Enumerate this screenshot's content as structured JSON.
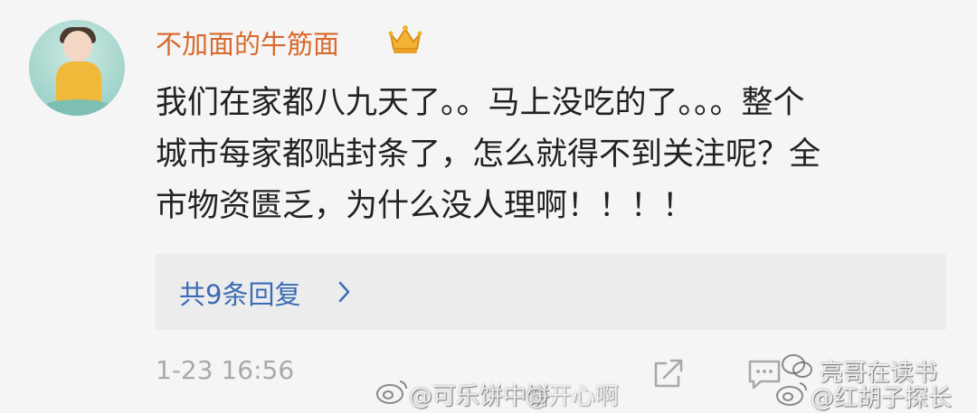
{
  "post": {
    "username": "不加面的牛筋面",
    "comment_lines": [
      "我们在家都八九天了。。马上没吃的了。。。整个",
      "城市每家都贴封条了，怎么就得不到关注呢？全",
      "市物资匮乏，为什么没人理啊！！！！"
    ],
    "replies_label": "共9条回复",
    "timestamp": "1-23 16:56"
  },
  "icons": {
    "badge": "crown-icon",
    "replies": "chevron-right-icon",
    "share": "share-icon",
    "comment": "comment-icon"
  },
  "watermarks": {
    "left": "@可乐饼中饼",
    "overlap": "@开心啊",
    "right_top": "亮哥在读书",
    "right_bottom": "@红胡子探长"
  },
  "colors": {
    "username": "#d9682c",
    "link": "#3a6bb5",
    "text": "#222222",
    "meta": "#a9a9a9",
    "background": "#f5f5f5",
    "reply_box": "#ececec"
  }
}
